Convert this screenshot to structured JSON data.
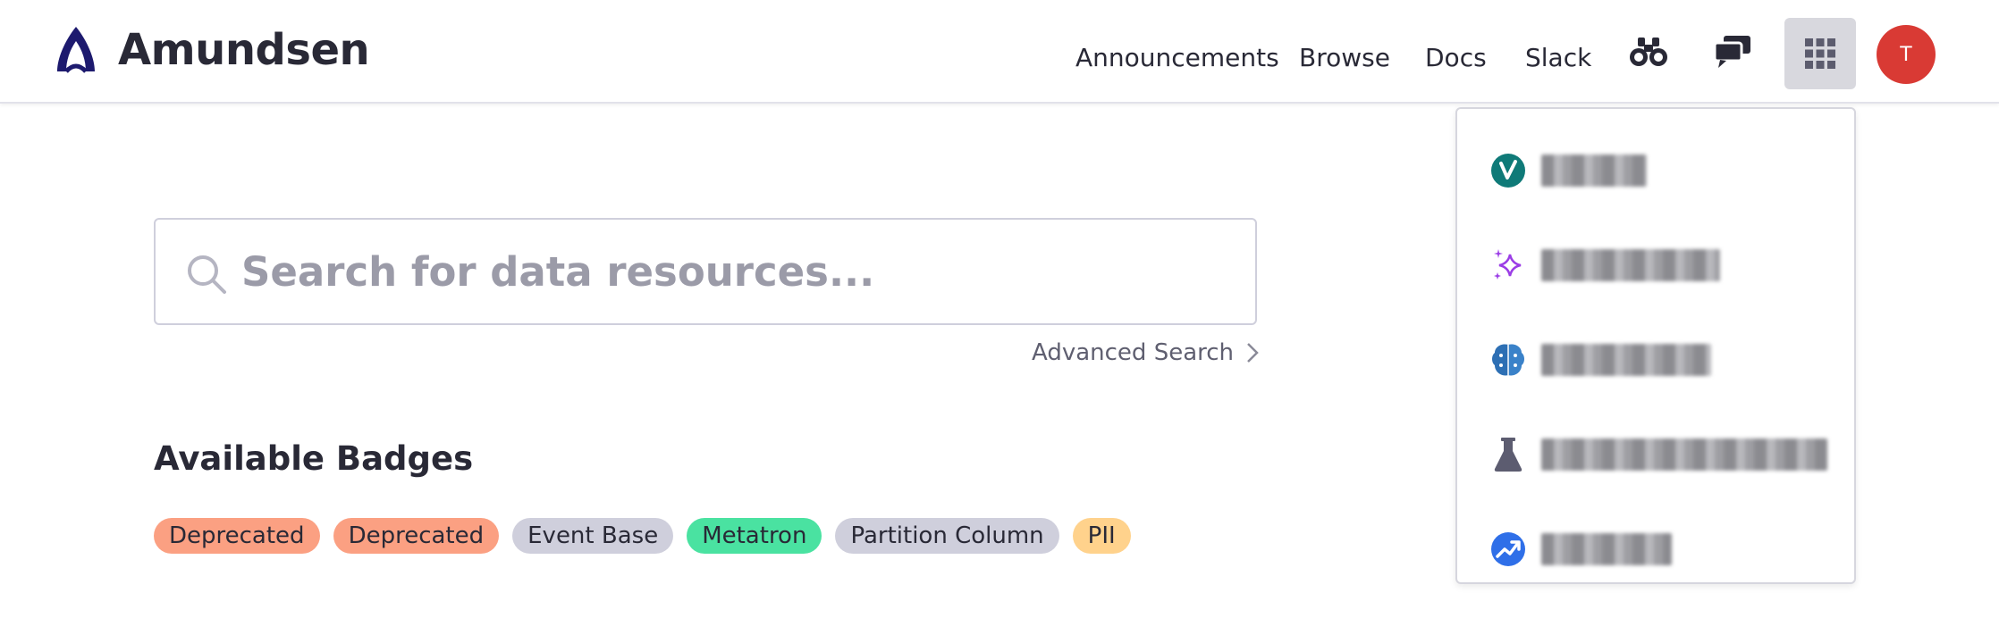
{
  "app": {
    "title": "Amundsen"
  },
  "nav": {
    "links": [
      {
        "label": "Announcements"
      },
      {
        "label": "Browse"
      },
      {
        "label": "Docs"
      },
      {
        "label": "Slack"
      }
    ],
    "icons": [
      "binoculars-icon",
      "chat-icon",
      "apps-grid-icon"
    ],
    "avatar_initial": "T"
  },
  "search": {
    "placeholder": "Search for data resources...",
    "value": "",
    "advanced_label": "Advanced Search"
  },
  "badges": {
    "title": "Available Badges",
    "items": [
      {
        "label": "Deprecated",
        "color": "#fba082"
      },
      {
        "label": "Deprecated",
        "color": "#fba082"
      },
      {
        "label": "Event Base",
        "color": "#cfcfdc"
      },
      {
        "label": "Metatron",
        "color": "#4ae2a1"
      },
      {
        "label": "Partition Column",
        "color": "#cfcfdc"
      },
      {
        "label": "PII",
        "color": "#ffd28c"
      }
    ]
  },
  "apps_menu": {
    "items": [
      {
        "icon": "v-check-icon",
        "label": "",
        "icon_color": "#0f7a78"
      },
      {
        "icon": "sparkle-icon",
        "label": "",
        "icon_color": "#9b3de6"
      },
      {
        "icon": "brain-icon",
        "label": "",
        "icon_color": "#2d6fb4"
      },
      {
        "icon": "flask-icon",
        "label": "",
        "icon_color": "#5c5c70"
      },
      {
        "icon": "trend-chart-icon",
        "label": "",
        "icon_color": "#2f6fe8"
      }
    ]
  },
  "colors": {
    "brand": "#1d1a6e",
    "avatar": "#d93a34",
    "text": "#292936",
    "apps_button_bg": "#d8d8de"
  }
}
